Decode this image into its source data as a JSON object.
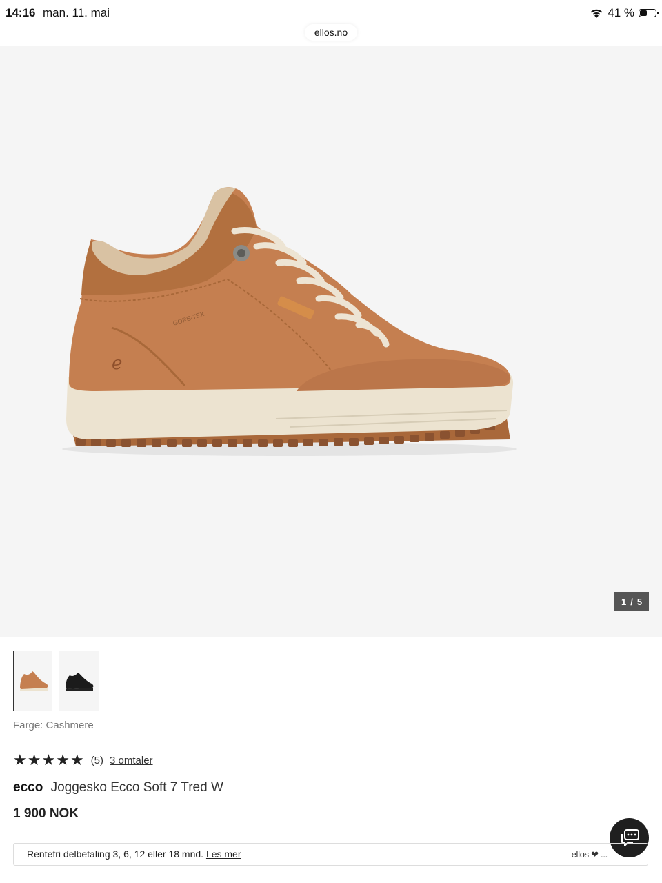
{
  "status_bar": {
    "time": "14:16",
    "date": "man. 11. mai",
    "battery": "41 %",
    "battery_level": 0.41,
    "wifi_icon": "wifi-icon",
    "battery_icon": "battery-icon"
  },
  "browser": {
    "url": "ellos.no"
  },
  "gallery": {
    "current": "1",
    "separator": "/",
    "total": "5",
    "colors": {
      "background": "#f5f5f5",
      "counter_bg": "#555555"
    }
  },
  "variants": {
    "color_label": "Farge: Cashmere"
  },
  "rating": {
    "stars": 5,
    "count": "(5)",
    "reviews_link": "3 omtaler"
  },
  "product": {
    "brand": "ecco",
    "name": "Joggesko Ecco Soft 7 Tred W",
    "price": "1 900 NOK",
    "image_gore_tex_label": "GORE-TEX"
  },
  "finance": {
    "text": "Rentefri delbetaling 3, 6, 12 eller 18 mnd.",
    "link": "Les mer",
    "logo": "ellos ❤ ..."
  },
  "chat": {
    "icon": "chat-icon"
  }
}
